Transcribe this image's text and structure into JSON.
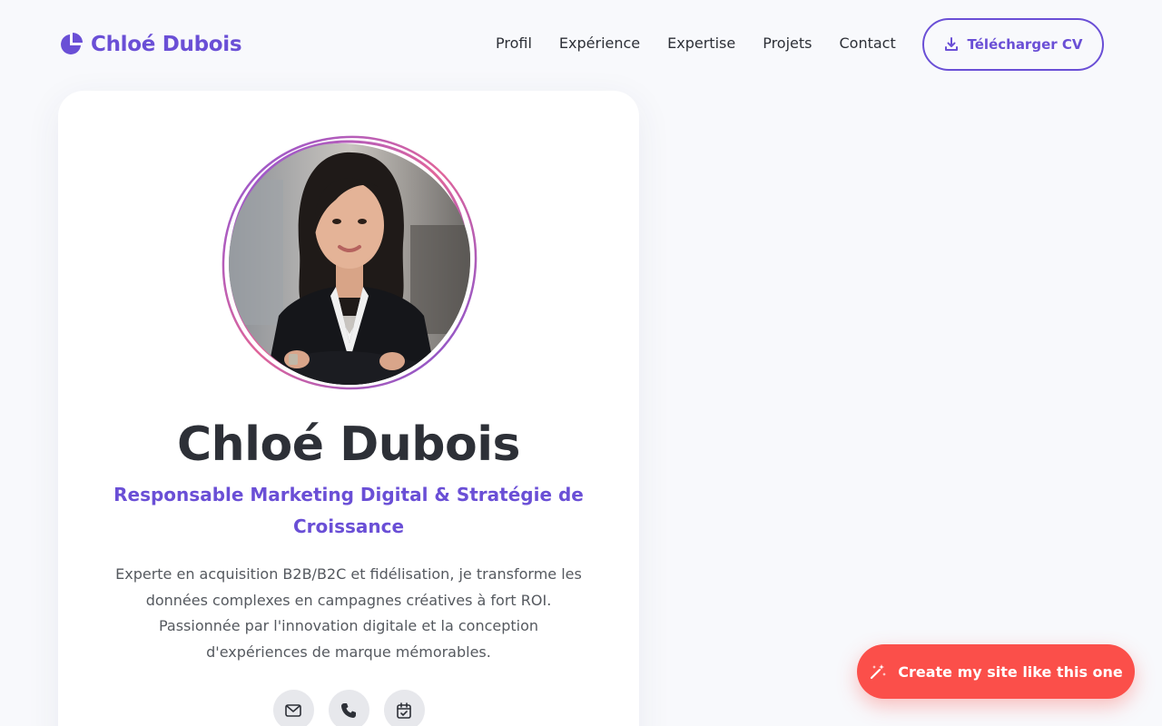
{
  "header": {
    "logo_text": "Chloé Dubois",
    "nav": [
      "Profil",
      "Expérience",
      "Expertise",
      "Projets",
      "Contact"
    ],
    "cv_button": "Télécharger CV"
  },
  "profile": {
    "name": "Chloé Dubois",
    "title": "Responsable Marketing Digital & Stratégie de Croissance",
    "bio": "Experte en acquisition B2B/B2C et fidélisation, je transforme les données complexes en campagnes créatives à fort ROI. Passionnée par l'innovation digitale et la conception d'expériences de marque mémorables."
  },
  "socials": [
    {
      "icon": "email-icon"
    },
    {
      "icon": "phone-icon"
    },
    {
      "icon": "calendar-icon"
    }
  ],
  "cta": {
    "label": "Create my site like this one"
  },
  "colors": {
    "accent": "#6a4fd6",
    "accent_pink": "#e0659a",
    "background": "#f8f9fc",
    "card": "#ffffff",
    "cta": "#fb4f4a",
    "text": "#2d3037"
  }
}
